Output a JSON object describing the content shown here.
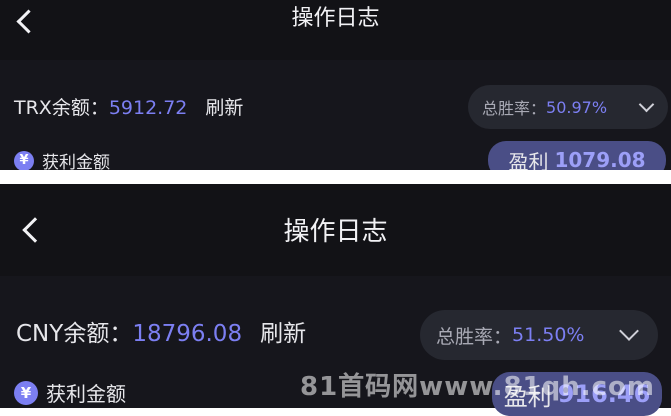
{
  "screens": [
    {
      "title": "操作日志",
      "balance_label": "TRX余额：",
      "balance_value": "5912.72",
      "refresh_label": "刷新",
      "win_rate_label": "总胜率：",
      "win_rate_value": "50.97%",
      "profit_amount_label": "获利金额",
      "profit_badge_label": "盈利",
      "profit_badge_value": "1079.08"
    },
    {
      "title": "操作日志",
      "balance_label": "CNY余额：",
      "balance_value": "18796.08",
      "refresh_label": "刷新",
      "win_rate_label": "总胜率：",
      "win_rate_value": "51.50%",
      "profit_amount_label": "获利金额",
      "profit_badge_label": "盈利",
      "profit_badge_value": "916.46"
    }
  ],
  "icons": {
    "back": "chevron-left-icon",
    "dropdown": "chevron-down-icon",
    "yen": "yen-icon",
    "yen_symbol": "¥"
  },
  "watermark": "81首码网www.81qh.com",
  "colors": {
    "background": "#16161c",
    "header": "#121216",
    "accent": "#7c7ff2",
    "badge": "#4a4e86",
    "pill": "#262830"
  }
}
